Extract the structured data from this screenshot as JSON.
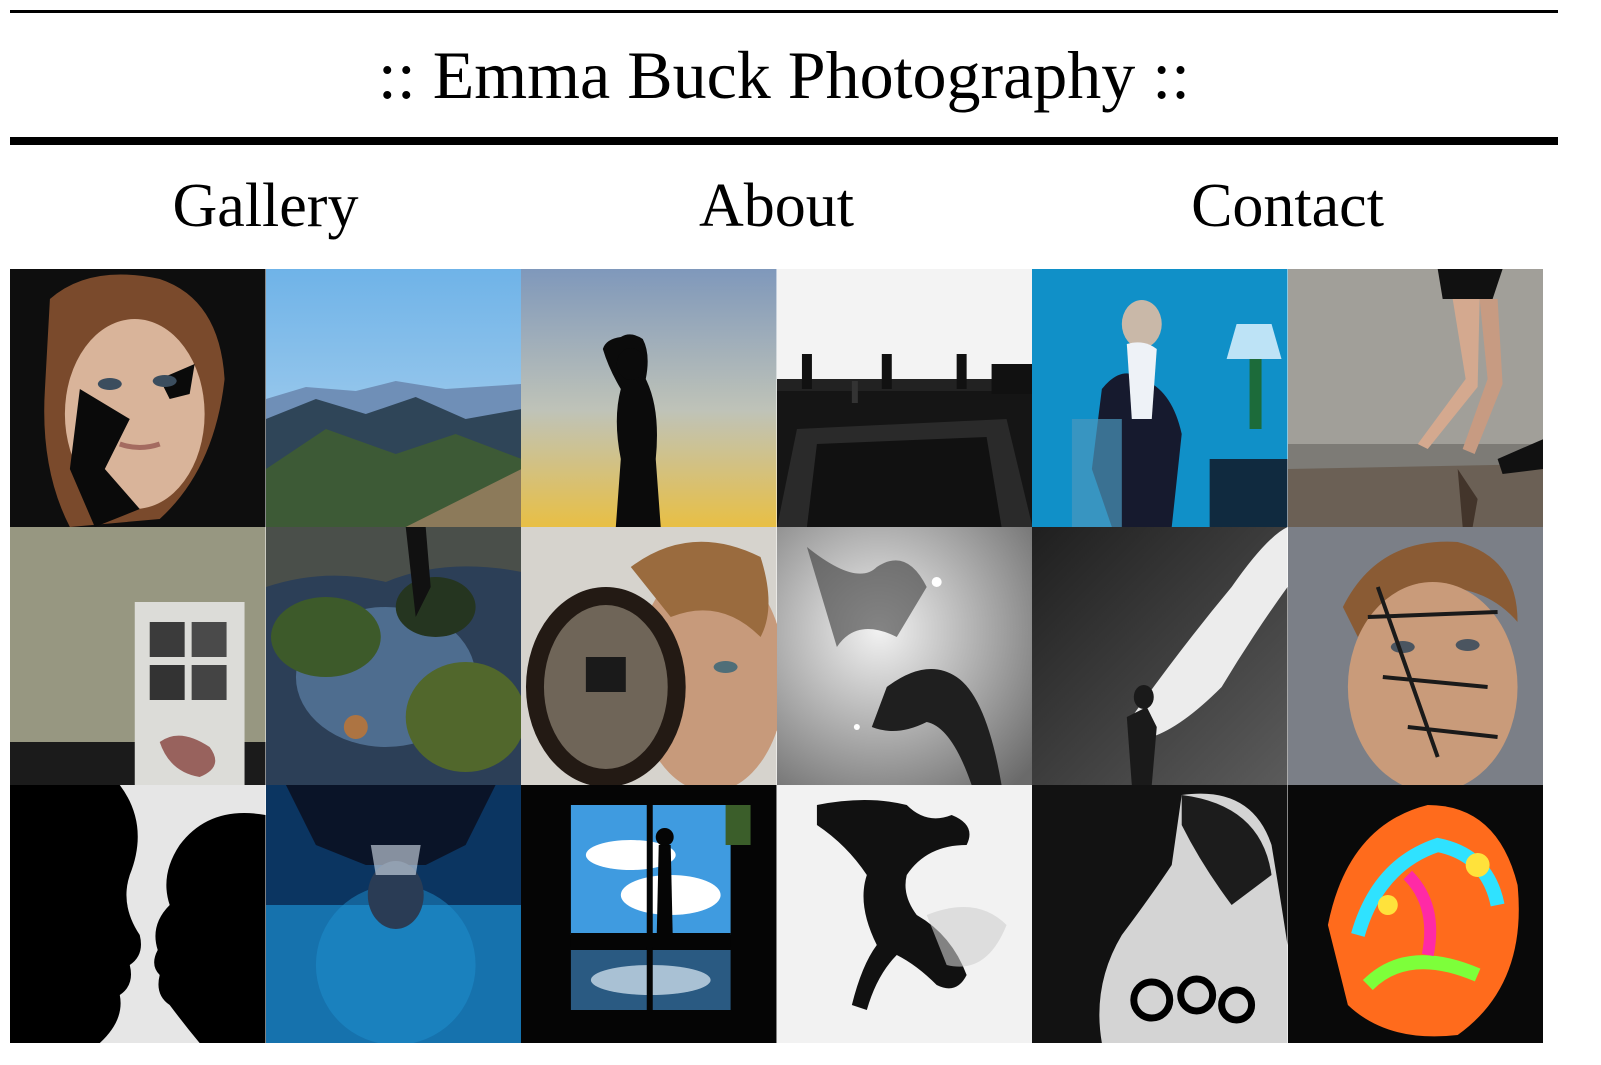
{
  "site": {
    "title": ":: Emma Buck Photography ::"
  },
  "nav": [
    {
      "label": "Gallery"
    },
    {
      "label": "About"
    },
    {
      "label": "Contact"
    }
  ],
  "gallery": {
    "tiles": [
      {
        "subject": "portrait-face-paint",
        "colors": [
          "#111111",
          "#c9a58a"
        ]
      },
      {
        "subject": "mountain-landscape",
        "colors": [
          "#7fb8e6",
          "#2e4a36"
        ]
      },
      {
        "subject": "sunset-silhouette",
        "colors": [
          "#8fa5c2",
          "#e6c35c"
        ]
      },
      {
        "subject": "rooftop-silhouette",
        "colors": [
          "#f0f0f0",
          "#151515"
        ]
      },
      {
        "subject": "underwater-suit-lamp",
        "colors": [
          "#0d8cc4",
          "#1a1a2a"
        ]
      },
      {
        "subject": "ballet-legs",
        "colors": [
          "#9a9a96",
          "#c7a58a"
        ]
      },
      {
        "subject": "abandoned-door",
        "colors": [
          "#a7a68f",
          "#e8e8e8"
        ]
      },
      {
        "subject": "tree-reflection",
        "colors": [
          "#2f4a6e",
          "#4f6b2d"
        ]
      },
      {
        "subject": "mirror-self-portrait",
        "colors": [
          "#d9d6d0",
          "#3a2a1e"
        ]
      },
      {
        "subject": "underwater-bw",
        "colors": [
          "#c8c8c8",
          "#2a2a2a"
        ]
      },
      {
        "subject": "white-cloth",
        "colors": [
          "#3a3a3a",
          "#e8e8e8"
        ]
      },
      {
        "subject": "written-face",
        "colors": [
          "#7a7e85",
          "#c79b7a"
        ]
      },
      {
        "subject": "kiss-silhouette",
        "colors": [
          "#e9e9e9",
          "#000000"
        ]
      },
      {
        "subject": "inverted-underwater-blue",
        "colors": [
          "#0c3a66",
          "#1a8fd0"
        ]
      },
      {
        "subject": "window-silhouette",
        "colors": [
          "#050505",
          "#4aa6e8"
        ]
      },
      {
        "subject": "falling-figure-bw",
        "colors": [
          "#f2f2f2",
          "#111111"
        ]
      },
      {
        "subject": "painted-back",
        "colors": [
          "#121212",
          "#d0d0d0"
        ]
      },
      {
        "subject": "neon-body-paint",
        "colors": [
          "#0a0a0a",
          "#ff6a1a"
        ]
      }
    ]
  }
}
